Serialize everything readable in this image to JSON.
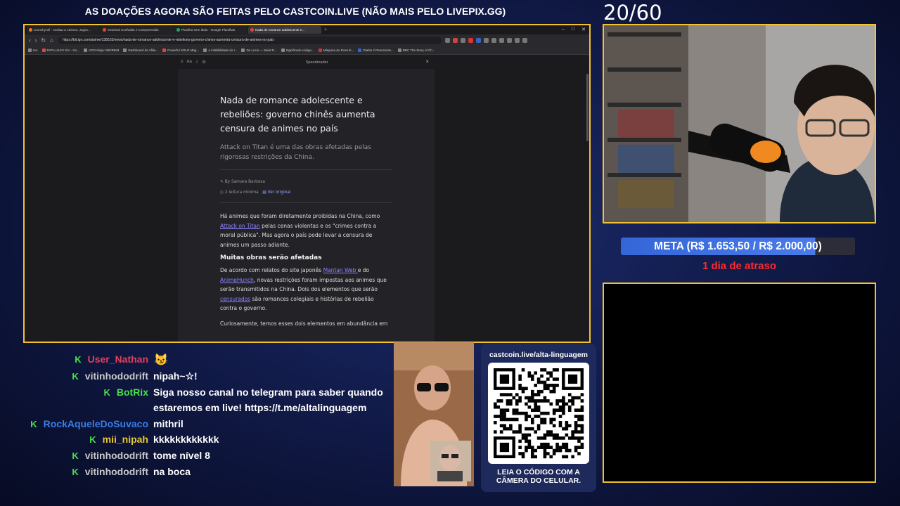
{
  "banner": {
    "text": "AS DOAÇÕES AGORA SÃO FEITAS PELO CASTCOIN.LIVE (NÃO MAIS PELO LIVEPIX.GG)"
  },
  "counter": "20/60",
  "browser": {
    "tabs": [
      {
        "label": "Crunchyroll - Assista a Animes, Jogos...",
        "color": "#f47521",
        "active": false
      },
      {
        "label": "Overlord Confusão e Compreensão",
        "color": "#e0492f",
        "active": false
      },
      {
        "label": "Planilha sem título - Google Planilhas",
        "color": "#21a464",
        "active": false
      },
      {
        "label": "Nada de romance adolescente e...",
        "color": "#e0492f",
        "active": true
      }
    ],
    "url": "https://bit.ign.com/anime/138533/news/nada-de-romance-adolescente-e-rebelioes-governo-chines-aumenta-censura-de-animes-no-pais",
    "bookmarks": [
      "IAs",
      "PAPA LEÃO XIV - Go...",
      "VOO.Ninja: MIORIM3",
      "Dashboard do Afiliа...",
      "Powerful SOLO Mag...",
      "A infalibilidade do I...",
      "De Lucis — Saint R...",
      "Significado código...",
      "Máquina do Rose-E...",
      "Diablo 2 Resurrecte...",
      "BBC The Story of Ch..."
    ],
    "reader_title": "Speedreader",
    "article": {
      "title": "Nada de romance adolescente e rebeliões: governo chinês aumenta censura de animes no país",
      "subtitle": "Attack on Titan é uma das obras afetadas pelas rigorosas restrições da China.",
      "author": "By Samara Barbosa",
      "reading_time": "2 leitura mínima",
      "view_original": "Ver original",
      "p1_start": "Há animes que foram diretamente proibidas na China, como ",
      "p1_link": "Attack on Titan",
      "p1_end": " pelas cenas violentas e os \"crimes contra a moral pública\". Mas agora o país pode levar a censura de animes um passo adiante.",
      "h2": "Muitas obras serão afetadas",
      "p2_a": "De acordo com relatos do site japonês ",
      "p2_link1": "Mantan Web ",
      "p2_b": "e do ",
      "p2_link2": "AnimeHunch",
      "p2_c": ", novas restrições foram impostas aos animes que serão transmitidos na China. Dois dos elementos que serão ",
      "p2_link3": "censurados",
      "p2_d": " são romances colegiais e histórias de rebelião contra o governo.",
      "p3": "Curiosamente, temos esses dois elementos em abundância em"
    }
  },
  "goal": {
    "label": "META (R$ 1.653,50 / R$ 2.000,00)",
    "progress": 0.8268
  },
  "delay": "1 dia de atraso",
  "chat": [
    {
      "user": "User_Nathan",
      "color": "#e0405a",
      "message": ""
    },
    {
      "user": "vitinhododrift",
      "color": "#c8c8c8",
      "message": "nipah~☆!"
    },
    {
      "user": "BotRix",
      "color": "#48e04a",
      "message": "Siga nosso canal no telegram para saber quando",
      "message2": "estaremos em live! https://t.me/altalinguagem"
    },
    {
      "user": "RockAqueleDoSuvaco",
      "color": "#3a7ee8",
      "message": "mithril"
    },
    {
      "user": "mii_nipah",
      "color": "#e8c832",
      "message": "kkkkkkkkkkkk"
    },
    {
      "user": "vitinhododrift",
      "color": "#c8c8c8",
      "message": "tome nível 8"
    },
    {
      "user": "vitinhododrift",
      "color": "#c8c8c8",
      "message": "na boca"
    }
  ],
  "qr": {
    "title": "castcoin.live/alta-linguagem",
    "footer_line1": "LEIA O CÓDIGO COM A",
    "footer_line2": "CÂMERA DO CELULAR."
  },
  "colors": {
    "frame": "#f2c230",
    "meta_bar": "#4a7be8",
    "delay": "#ff2a2a"
  }
}
